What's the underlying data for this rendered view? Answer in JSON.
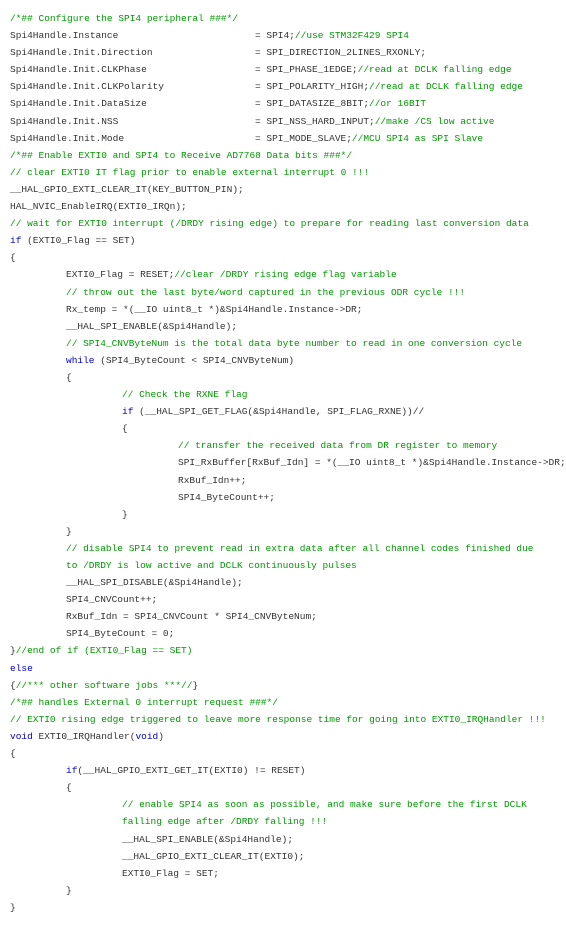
{
  "lines": [
    {
      "cls": "line",
      "parts": [
        {
          "t": "/*## Configure the SPI4 peripheral ###*/",
          "c": "cmt"
        }
      ]
    },
    {
      "cls": "line",
      "parts": [
        {
          "t": "Spi4Handle.Instance",
          "w": "pad1"
        },
        {
          "t": "= SPI4;"
        },
        {
          "t": "//use STM32F429 SPI4",
          "c": "cmt"
        }
      ]
    },
    {
      "cls": "line",
      "parts": [
        {
          "t": "Spi4Handle.Init.Direction",
          "w": "pad1"
        },
        {
          "t": "= SPI_DIRECTION_2LINES_RXONLY;"
        }
      ]
    },
    {
      "cls": "line",
      "parts": [
        {
          "t": "Spi4Handle.Init.CLKPhase",
          "w": "pad1"
        },
        {
          "t": "= SPI_PHASE_1EDGE;"
        },
        {
          "t": "//read at DCLK falling edge",
          "c": "cmt"
        }
      ]
    },
    {
      "cls": "line",
      "parts": [
        {
          "t": "Spi4Handle.Init.CLKPolarity",
          "w": "pad1"
        },
        {
          "t": "= SPI_POLARITY_HIGH;"
        },
        {
          "t": "//read at DCLK falling edge",
          "c": "cmt"
        }
      ]
    },
    {
      "cls": "line",
      "parts": [
        {
          "t": "Spi4Handle.Init.DataSize",
          "w": "pad1"
        },
        {
          "t": "= SPI_DATASIZE_8BIT;"
        },
        {
          "t": "//or 16BIT",
          "c": "cmt"
        }
      ]
    },
    {
      "cls": "line",
      "parts": [
        {
          "t": "Spi4Handle.Init.NSS",
          "w": "pad1"
        },
        {
          "t": "= SPI_NSS_HARD_INPUT;"
        },
        {
          "t": "//make /CS low active",
          "c": "cmt"
        }
      ]
    },
    {
      "cls": "line",
      "parts": [
        {
          "t": "Spi4Handle.Init.Mode",
          "w": "pad1"
        },
        {
          "t": "= SPI_MODE_SLAVE;"
        },
        {
          "t": "//MCU SPI4 as SPI Slave",
          "c": "cmt"
        }
      ]
    },
    {
      "cls": "line",
      "parts": [
        {
          "t": "/*## Enable EXTI0 and SPI4 to Receive AD7768 Data bits ###*/",
          "c": "cmt"
        }
      ]
    },
    {
      "cls": "line",
      "parts": [
        {
          "t": "// clear EXTI0 IT flag prior to enable external interrupt 0 !!!",
          "c": "cmt"
        }
      ]
    },
    {
      "cls": "line",
      "parts": [
        {
          "t": "__HAL_GPIO_EXTI_CLEAR_IT(KEY_BUTTON_PIN);"
        }
      ]
    },
    {
      "cls": "line",
      "parts": [
        {
          "t": "HAL_NVIC_EnableIRQ(EXTI0_IRQn);"
        }
      ]
    },
    {
      "cls": "line",
      "parts": [
        {
          "t": "// wait for EXTI0 interrupt (/DRDY rising edge) to prepare for reading last conversion data",
          "c": "cmt"
        }
      ]
    },
    {
      "cls": "line",
      "parts": [
        {
          "t": "if ",
          "c": "kw"
        },
        {
          "t": "(EXTI0_Flag == SET)"
        }
      ]
    },
    {
      "cls": "line",
      "parts": [
        {
          "t": "{"
        }
      ]
    },
    {
      "cls": "line indent1",
      "parts": [
        {
          "t": "EXTI0_Flag = RESET;"
        },
        {
          "t": "//clear /DRDY rising edge flag variable",
          "c": "cmt"
        }
      ]
    },
    {
      "cls": "line indent1",
      "parts": [
        {
          "t": "// throw out the last byte/word captured in the previous ODR cycle !!!",
          "c": "cmt"
        }
      ]
    },
    {
      "cls": "line indent1",
      "parts": [
        {
          "t": "Rx_temp = *(__IO uint8_t *)&Spi4Handle.Instance->DR;"
        }
      ]
    },
    {
      "cls": "line indent1",
      "parts": [
        {
          "t": "__HAL_SPI_ENABLE(&Spi4Handle);"
        }
      ]
    },
    {
      "cls": "line indent1",
      "parts": [
        {
          "t": "// SPI4_CNVByteNum is the total data byte number to read in one conversion cycle",
          "c": "cmt"
        }
      ]
    },
    {
      "cls": "line indent1",
      "parts": [
        {
          "t": "while ",
          "c": "kw"
        },
        {
          "t": "(SPI4_ByteCount < SPI4_CNVByteNum)"
        }
      ]
    },
    {
      "cls": "line indent1",
      "parts": [
        {
          "t": "{"
        }
      ]
    },
    {
      "cls": "line indent2",
      "parts": [
        {
          "t": "// Check the RXNE flag",
          "c": "cmt"
        }
      ]
    },
    {
      "cls": "line indent2",
      "parts": [
        {
          "t": "if ",
          "c": "kw"
        },
        {
          "t": "(__HAL_SPI_GET_FLAG(&Spi4Handle, SPI_FLAG_RXNE))//"
        }
      ]
    },
    {
      "cls": "line indent2",
      "parts": [
        {
          "t": "{"
        }
      ]
    },
    {
      "cls": "line indent3",
      "parts": [
        {
          "t": "// transfer the received data from DR register to memory",
          "c": "cmt"
        }
      ]
    },
    {
      "cls": "line indent3",
      "parts": [
        {
          "t": "SPI_RxBuffer[RxBuf_Idn] = *(__IO uint8_t *)&Spi4Handle.Instance->DR;"
        }
      ]
    },
    {
      "cls": "line indent3",
      "parts": [
        {
          "t": "RxBuf_Idn++;"
        }
      ]
    },
    {
      "cls": "line indent3",
      "parts": [
        {
          "t": "SPI4_ByteCount++;"
        }
      ]
    },
    {
      "cls": "line indent2",
      "parts": [
        {
          "t": "}"
        }
      ]
    },
    {
      "cls": "line indent1",
      "parts": [
        {
          "t": "}"
        }
      ]
    },
    {
      "cls": "line indent1",
      "parts": [
        {
          "t": "// disable SPI4 to prevent read in extra data after all channel codes finished due to /DRDY is low active and DCLK continuously pulses",
          "c": "cmt",
          "wrap": true
        }
      ]
    },
    {
      "cls": "line indent1",
      "parts": [
        {
          "t": "__HAL_SPI_DISABLE(&Spi4Handle);"
        }
      ]
    },
    {
      "cls": "line indent1",
      "parts": [
        {
          "t": "SPI4_CNVCount++;"
        }
      ]
    },
    {
      "cls": "line indent1",
      "parts": [
        {
          "t": "RxBuf_Idn = SPI4_CNVCount * SPI4_CNVByteNum;"
        }
      ]
    },
    {
      "cls": "line indent1",
      "parts": [
        {
          "t": "SPI4_ByteCount = 0;"
        }
      ]
    },
    {
      "cls": "line",
      "parts": [
        {
          "t": "}"
        },
        {
          "t": "//end of if (EXTI0_Flag == SET)",
          "c": "cmt"
        }
      ]
    },
    {
      "cls": "line",
      "parts": [
        {
          "t": "else",
          "c": "kw"
        }
      ]
    },
    {
      "cls": "line",
      "parts": [
        {
          "t": "{"
        },
        {
          "t": "//*** other software jobs ***//",
          "c": "cmt"
        },
        {
          "t": "}"
        }
      ]
    },
    {
      "cls": "line",
      "parts": [
        {
          "t": "/*## handles External 0 interrupt request ###*/",
          "c": "cmt"
        }
      ]
    },
    {
      "cls": "line",
      "parts": [
        {
          "t": "// EXTI0 rising edge triggered to leave more response time for going into EXTI0_IRQHandler !!!",
          "c": "cmt"
        }
      ]
    },
    {
      "cls": "line",
      "parts": [
        {
          "t": "void ",
          "c": "kw"
        },
        {
          "t": "EXTI0_IRQHandler("
        },
        {
          "t": "void",
          "c": "kw"
        },
        {
          "t": ")"
        }
      ]
    },
    {
      "cls": "line",
      "parts": [
        {
          "t": "{"
        }
      ]
    },
    {
      "cls": "line indent1",
      "parts": [
        {
          "t": "if",
          "c": "kw"
        },
        {
          "t": "(__HAL_GPIO_EXTI_GET_IT(EXTI0) != RESET)"
        }
      ]
    },
    {
      "cls": "line indent1",
      "parts": [
        {
          "t": "{"
        }
      ]
    },
    {
      "cls": "line indent2",
      "parts": [
        {
          "t": "// enable SPI4 as soon as possible, and make sure before the first DCLK falling edge after /DRDY falling !!!",
          "c": "cmt",
          "wrap": true
        }
      ]
    },
    {
      "cls": "line indent2",
      "parts": [
        {
          "t": "__HAL_SPI_ENABLE(&Spi4Handle);"
        }
      ]
    },
    {
      "cls": "line indent2",
      "parts": [
        {
          "t": "__HAL_GPIO_EXTI_CLEAR_IT(EXTI0);"
        }
      ]
    },
    {
      "cls": "line indent2",
      "parts": [
        {
          "t": "EXTI0_Flag = SET;"
        }
      ]
    },
    {
      "cls": "line indent1",
      "parts": [
        {
          "t": "}"
        }
      ]
    },
    {
      "cls": "line",
      "parts": [
        {
          "t": "}"
        }
      ]
    }
  ]
}
